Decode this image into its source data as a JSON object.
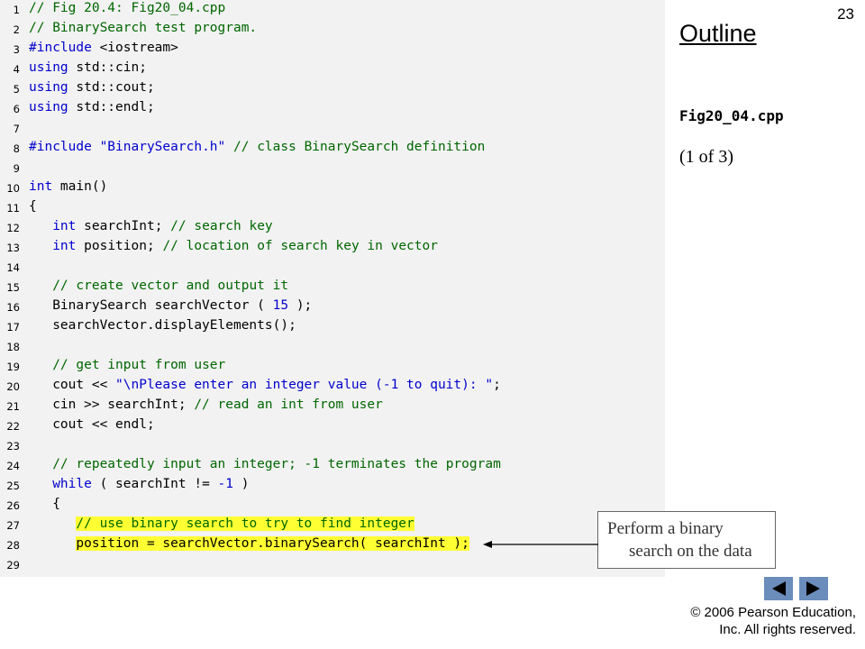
{
  "slide_number": "23",
  "outline_title": "Outline",
  "file_name": "Fig20_04.cpp",
  "page_indicator": "(1 of 3)",
  "callout": {
    "line1": "Perform a binary",
    "line2": "search on the data"
  },
  "copyright": {
    "line1": "© 2006 Pearson Education,",
    "line2": "Inc.  All rights reserved."
  },
  "icons": {
    "prev": "triangle-left-icon",
    "next": "triangle-right-icon"
  },
  "colors": {
    "code_bg": "#f2f2f2",
    "comment": "#006600",
    "keyword": "#0000cc",
    "highlight": "#ffff33",
    "nav": "#6b8dbb"
  },
  "code": [
    {
      "num": "1",
      "tokens": [
        {
          "t": "// Fig 20.4: Fig20_04.cpp",
          "c": "comment"
        }
      ]
    },
    {
      "num": "2",
      "tokens": [
        {
          "t": "// BinarySearch test program.",
          "c": "comment"
        }
      ]
    },
    {
      "num": "3",
      "tokens": [
        {
          "t": "#include",
          "c": "keyword"
        },
        {
          "t": " <iostream>"
        }
      ]
    },
    {
      "num": "4",
      "tokens": [
        {
          "t": "using",
          "c": "keyword"
        },
        {
          "t": " std::cin;"
        }
      ]
    },
    {
      "num": "5",
      "tokens": [
        {
          "t": "using",
          "c": "keyword"
        },
        {
          "t": " std::cout;"
        }
      ]
    },
    {
      "num": "6",
      "tokens": [
        {
          "t": "using",
          "c": "keyword"
        },
        {
          "t": " std::endl;"
        }
      ]
    },
    {
      "num": "7",
      "tokens": []
    },
    {
      "num": "8",
      "tokens": [
        {
          "t": "#include",
          "c": "keyword"
        },
        {
          "t": " "
        },
        {
          "t": "\"BinarySearch.h\"",
          "c": "string"
        },
        {
          "t": " "
        },
        {
          "t": "// class BinarySearch definition",
          "c": "comment"
        }
      ]
    },
    {
      "num": "9",
      "tokens": []
    },
    {
      "num": "10",
      "tokens": [
        {
          "t": "int",
          "c": "keyword"
        },
        {
          "t": " main()"
        }
      ]
    },
    {
      "num": "11",
      "tokens": [
        {
          "t": "{"
        }
      ]
    },
    {
      "num": "12",
      "tokens": [
        {
          "t": "   "
        },
        {
          "t": "int",
          "c": "keyword"
        },
        {
          "t": " searchInt; "
        },
        {
          "t": "// search key",
          "c": "comment"
        }
      ]
    },
    {
      "num": "13",
      "tokens": [
        {
          "t": "   "
        },
        {
          "t": "int",
          "c": "keyword"
        },
        {
          "t": " position; "
        },
        {
          "t": "// location of search key in vector",
          "c": "comment"
        }
      ]
    },
    {
      "num": "14",
      "tokens": []
    },
    {
      "num": "15",
      "tokens": [
        {
          "t": "   "
        },
        {
          "t": "// create vector and output it",
          "c": "comment"
        }
      ]
    },
    {
      "num": "16",
      "tokens": [
        {
          "t": "   BinarySearch searchVector ( "
        },
        {
          "t": "15",
          "c": "number"
        },
        {
          "t": " );"
        }
      ]
    },
    {
      "num": "17",
      "tokens": [
        {
          "t": "   searchVector.displayElements();"
        }
      ]
    },
    {
      "num": "18",
      "tokens": []
    },
    {
      "num": "19",
      "tokens": [
        {
          "t": "   "
        },
        {
          "t": "// get input from user",
          "c": "comment"
        }
      ]
    },
    {
      "num": "20",
      "tokens": [
        {
          "t": "   cout << "
        },
        {
          "t": "\"\\nPlease enter an integer value (-1 to quit): \"",
          "c": "string"
        },
        {
          "t": ";"
        }
      ]
    },
    {
      "num": "21",
      "tokens": [
        {
          "t": "   cin >> searchInt; "
        },
        {
          "t": "// read an int from user",
          "c": "comment"
        }
      ]
    },
    {
      "num": "22",
      "tokens": [
        {
          "t": "   cout << endl;"
        }
      ]
    },
    {
      "num": "23",
      "tokens": []
    },
    {
      "num": "24",
      "tokens": [
        {
          "t": "   "
        },
        {
          "t": "// repeatedly input an integer; -1 terminates the program",
          "c": "comment"
        }
      ]
    },
    {
      "num": "25",
      "tokens": [
        {
          "t": "   "
        },
        {
          "t": "while",
          "c": "keyword"
        },
        {
          "t": " ( searchInt != "
        },
        {
          "t": "-1",
          "c": "number"
        },
        {
          "t": " )"
        }
      ]
    },
    {
      "num": "26",
      "tokens": [
        {
          "t": "   {"
        }
      ]
    },
    {
      "num": "27",
      "tokens": [
        {
          "t": "      "
        },
        {
          "t": "// use binary search to try to find integer",
          "c": "comment",
          "hl": true
        }
      ]
    },
    {
      "num": "28",
      "tokens": [
        {
          "t": "      "
        },
        {
          "t": "position = searchVector.binarySearch( searchInt );",
          "hl": true
        }
      ]
    },
    {
      "num": "29",
      "tokens": []
    }
  ]
}
